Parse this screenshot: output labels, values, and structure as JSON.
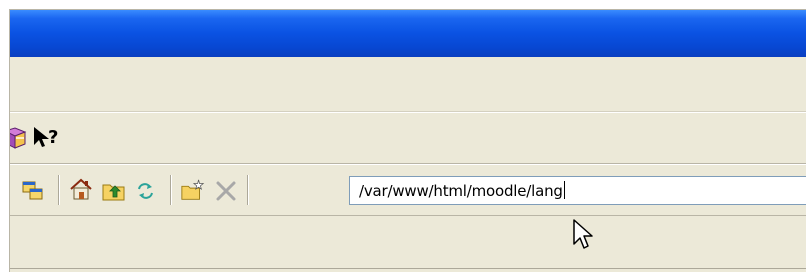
{
  "window": {
    "titlebar_color": "#0a52e2",
    "background_color": "#ece9d8"
  },
  "toolbar_top": {
    "items": [
      {
        "name": "help-book-icon"
      },
      {
        "name": "whats-this-help-icon"
      }
    ]
  },
  "toolbar_nav": {
    "items": [
      {
        "name": "copy-windows-icon"
      },
      {
        "name": "home-icon"
      },
      {
        "name": "up-folder-icon"
      },
      {
        "name": "refresh-icon"
      },
      {
        "name": "new-folder-icon"
      },
      {
        "name": "delete-icon"
      }
    ],
    "path_value": "/var/www/html/moodle/lang"
  },
  "mouse_pointer": {
    "name": "arrow-cursor-icon"
  }
}
